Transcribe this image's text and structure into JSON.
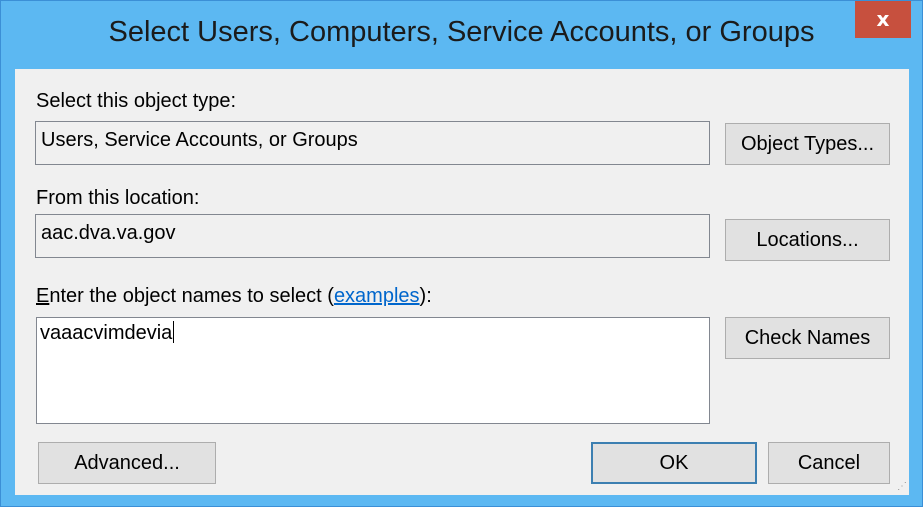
{
  "window": {
    "title": "Select Users, Computers, Service Accounts, or Groups",
    "close_glyph": "x"
  },
  "object_type": {
    "label": "Select this object type:",
    "value": "Users, Service Accounts, or Groups",
    "button": "Object Types..."
  },
  "location": {
    "label": "From this location:",
    "value": "aac.dva.va.gov",
    "button": "Locations..."
  },
  "names": {
    "label_prefix_underlined": "E",
    "label_prefix": "nter the object names to select (",
    "link": "examples",
    "label_suffix": "):",
    "value": "vaaacvimdevia",
    "check_button": "Check Names"
  },
  "footer": {
    "advanced_button": "Advanced...",
    "ok_button": "OK",
    "cancel_button": "Cancel"
  },
  "colors": {
    "titlebar": "#5cb8f2",
    "close_button": "#c7503e",
    "client": "#f0f0f0",
    "link": "#0066cc",
    "default_button_border": "#3c7fb1"
  }
}
